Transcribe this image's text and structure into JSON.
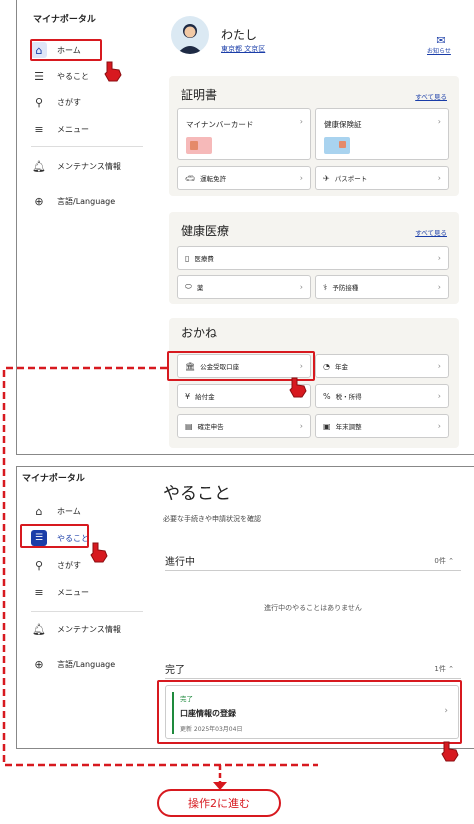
{
  "screen1": {
    "brand": "マイナポータル",
    "nav": [
      {
        "label": "ホーム",
        "icon": "home-icon"
      },
      {
        "label": "やること",
        "icon": "checklist-icon"
      },
      {
        "label": "さがす",
        "icon": "search-icon"
      },
      {
        "label": "メニュー",
        "icon": "menu-icon"
      },
      {
        "label": "メンテナンス情報",
        "icon": "bell-icon"
      },
      {
        "label": "言語/Language",
        "icon": "globe-icon"
      }
    ],
    "user": {
      "name": "わたし",
      "location": "東京都 文京区"
    },
    "notice_label": "お知らせ",
    "certificates": {
      "title": "証明書",
      "see_all": "すべて見る",
      "mynumber_card": "マイナンバーカード",
      "health_card": "健康保険証",
      "drivers_license": "運転免許",
      "passport": "パスポート"
    },
    "medical": {
      "title": "健康医療",
      "see_all": "すべて見る",
      "medical_cost": "医療費",
      "medicine": "薬",
      "vaccination": "予防接種"
    },
    "money": {
      "title": "おかね",
      "public_account": "公金受取口座",
      "pension": "年金",
      "benefits": "給付金",
      "tax_income": "税・所得",
      "tax_return": "確定申告",
      "year_end": "年末調整"
    }
  },
  "screen2": {
    "brand": "マイナポータル",
    "nav": [
      {
        "label": "ホーム",
        "icon": "home-icon"
      },
      {
        "label": "やること",
        "icon": "checklist-icon"
      },
      {
        "label": "さがす",
        "icon": "search-icon"
      },
      {
        "label": "メニュー",
        "icon": "menu-icon"
      },
      {
        "label": "メンテナンス情報",
        "icon": "bell-icon"
      },
      {
        "label": "言語/Language",
        "icon": "globe-icon"
      }
    ],
    "title": "やること",
    "subtitle": "必要な手続きや申請状況を確認",
    "in_progress": {
      "label": "進行中",
      "count": "0件",
      "empty": "進行中のやることはありません"
    },
    "done": {
      "label": "完了",
      "count": "1件",
      "item": {
        "status": "完了",
        "title": "口座情報の登録",
        "updated": "更新 2025年03月04日"
      }
    }
  },
  "next_step_label": "操作2に進む",
  "colors": {
    "accent_red": "#d7191f",
    "active_nav": "#1a3da8",
    "done_green": "#1e8a3c"
  }
}
